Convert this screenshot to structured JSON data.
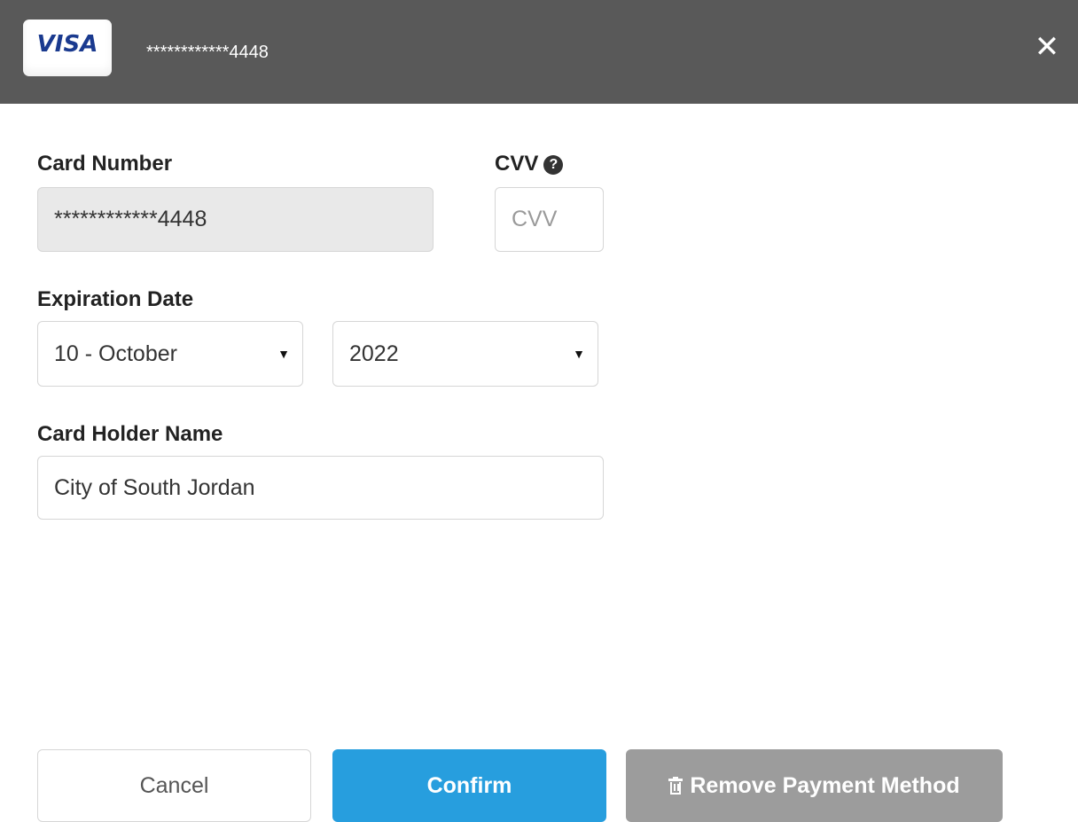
{
  "header": {
    "brand": "VISA",
    "masked_card": "************4448",
    "close_icon": "close-icon"
  },
  "form": {
    "card_number": {
      "label": "Card Number",
      "value": "************4448"
    },
    "cvv": {
      "label": "CVV",
      "placeholder": "CVV",
      "help_icon": "question-circle-icon"
    },
    "expiration": {
      "label": "Expiration Date",
      "month": "10 - October",
      "year": "2022"
    },
    "card_holder": {
      "label": "Card Holder Name",
      "value": "City of South Jordan"
    }
  },
  "buttons": {
    "cancel": "Cancel",
    "confirm": "Confirm",
    "remove": "Remove Payment Method",
    "remove_icon": "trash-icon"
  },
  "colors": {
    "header_bg": "#595959",
    "confirm_bg": "#279ede",
    "remove_bg": "#9c9c9c"
  }
}
